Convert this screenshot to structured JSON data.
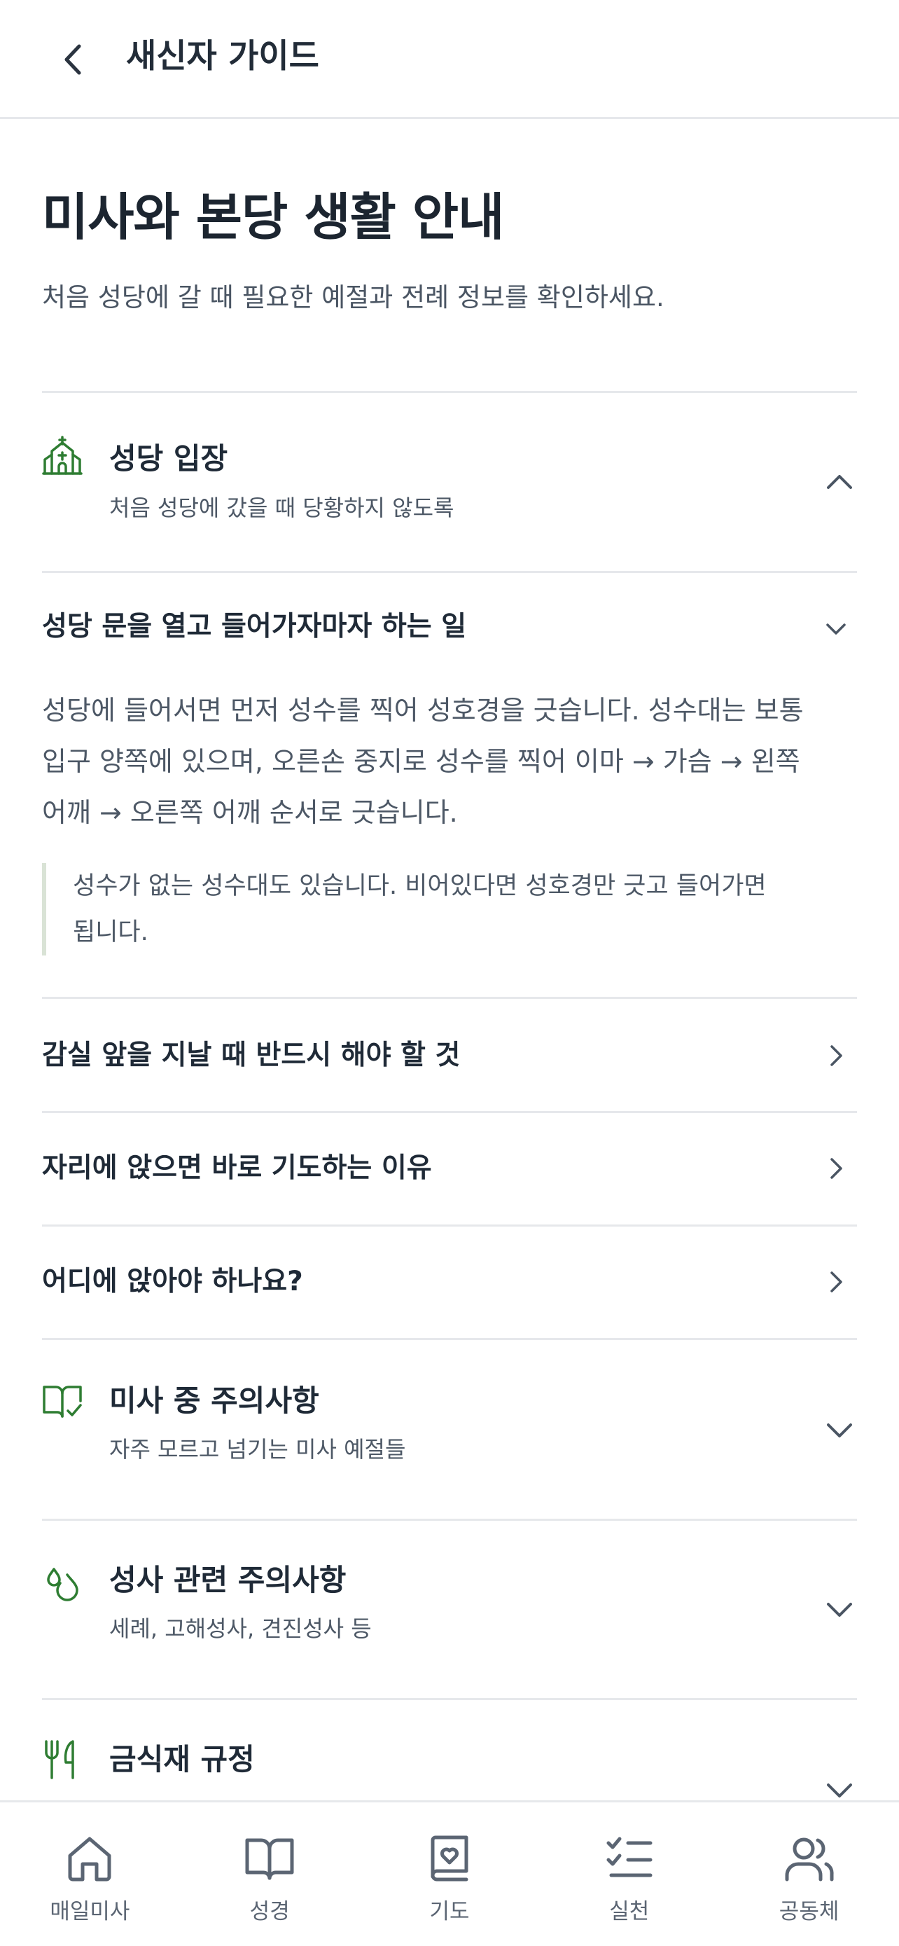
{
  "header": {
    "title": "새신자 가이드"
  },
  "page": {
    "title": "미사와 본당 생활 안내",
    "subtitle": "처음 성당에 갈 때 필요한 예절과 전례 정보를 확인하세요."
  },
  "sections": [
    {
      "icon": "church-icon",
      "title": "성당 입장",
      "subtitle": "처음 성당에 갔을 때 당황하지 않도록",
      "expanded": true,
      "items": [
        {
          "title": "성당 문을 열고 들어가자마자 하는 일",
          "expanded": true,
          "body_lines": [
            "성당에 들어서면 먼저 성수를 찍어 성호경을 긋습니다. 성수대는 보통",
            "입구 양쪽에 있으며, 오른손 중지로 성수를 찍어 이마 → 가슴 → 왼쪽",
            "어깨 → 오른쪽 어깨 순서로 긋습니다."
          ],
          "note_lines": [
            "성수가 없는 성수대도 있습니다. 비어있다면 성호경만 긋고 들어가면",
            "됩니다."
          ]
        },
        {
          "title": "감실 앞을 지날 때 반드시 해야 할 것"
        },
        {
          "title": "자리에 앉으면 바로 기도하는 이유"
        },
        {
          "title": "어디에 앉아야 하나요?"
        }
      ]
    },
    {
      "icon": "book-check-icon",
      "title": "미사 중 주의사항",
      "subtitle": "자주 모르고 넘기는 미사 예절들"
    },
    {
      "icon": "drops-icon",
      "title": "성사 관련 주의사항",
      "subtitle": "세례, 고해성사, 견진성사 등"
    },
    {
      "icon": "utensils-icon",
      "title": "금식재 규정",
      "subtitle": ""
    }
  ],
  "tabbar": {
    "tabs": [
      {
        "label": "매일미사",
        "icon": "home-icon"
      },
      {
        "label": "성경",
        "icon": "book-open-icon"
      },
      {
        "label": "기도",
        "icon": "prayer-book-icon"
      },
      {
        "label": "실천",
        "icon": "checklist-icon"
      },
      {
        "label": "공동체",
        "icon": "users-icon"
      }
    ]
  },
  "colors": {
    "accent": "#2e7d32",
    "text": "#1f2a37",
    "muted": "#4d5866",
    "divider": "#e6e8eb"
  }
}
